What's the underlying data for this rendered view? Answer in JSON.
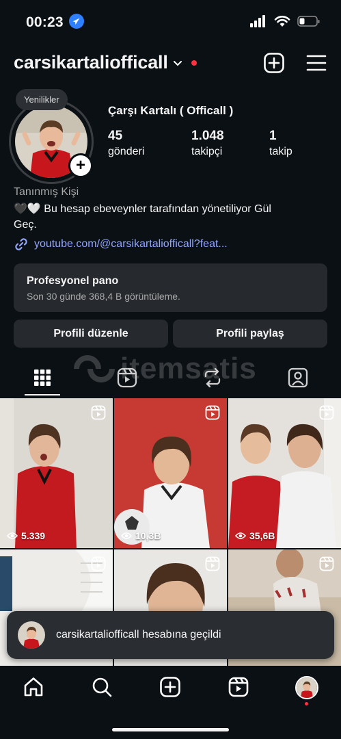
{
  "status_bar": {
    "time": "00:23"
  },
  "profile": {
    "username": "carsikartaliofficall",
    "display_name": "Çarşı Kartalı ( Officall )",
    "new_label": "Yenilikler",
    "stats": [
      {
        "value": "45",
        "label": "gönderi"
      },
      {
        "value": "1.048",
        "label": "takipçi"
      },
      {
        "value": "1",
        "label": "takip"
      }
    ],
    "category": "Tanınmış Kişi",
    "bio_line1": "🖤🤍 Bu hesap ebeveynler tarafından yönetiliyor Gül",
    "bio_line2": "Geç.",
    "link": "youtube.com/@carsikartaliofficall?feat..."
  },
  "dashboard": {
    "title": "Profesyonel pano",
    "subtitle": "Son 30 günde 368,4 B görüntüleme."
  },
  "buttons": {
    "edit_profile": "Profili düzenle",
    "share_profile": "Profili paylaş"
  },
  "watermark": "itemsatis",
  "posts": [
    {
      "views": "5.339",
      "type": "reel"
    },
    {
      "views": "10,3B",
      "type": "reel"
    },
    {
      "views": "35,6B",
      "type": "reel"
    },
    {
      "views": "",
      "type": "reel"
    },
    {
      "views": "",
      "type": "reel"
    },
    {
      "views": "",
      "type": "reel"
    }
  ],
  "toast": {
    "message": "carsikartaliofficall hesabına geçildi"
  },
  "icons": {
    "tabs": [
      "grid-icon",
      "reels-tab-icon",
      "reposts-icon",
      "tagged-icon"
    ],
    "nav": [
      "home-icon",
      "search-icon",
      "create-icon",
      "reels-icon",
      "profile-avatar"
    ]
  },
  "colors": {
    "background": "#0b1014",
    "surface": "#262a2f",
    "link": "#93a7ff",
    "notification": "#ff3040"
  }
}
